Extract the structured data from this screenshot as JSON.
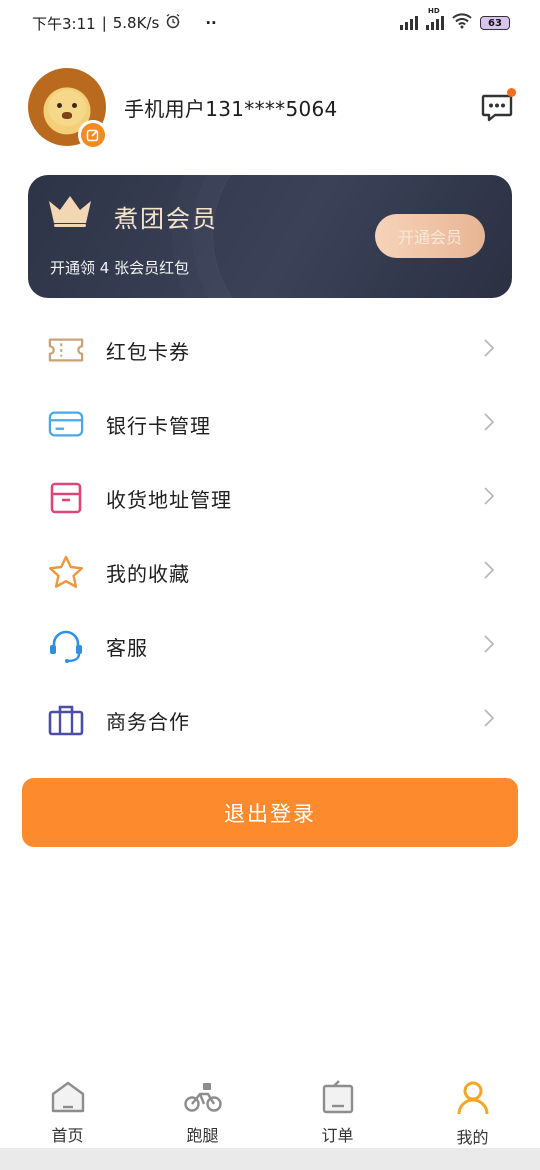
{
  "status_bar": {
    "time": "下午3:11",
    "speed": "5.8K/s",
    "dots": "··",
    "network_type": "HD",
    "battery": "63"
  },
  "profile": {
    "username": "手机用户131****5064"
  },
  "membership": {
    "title": "煮团会员",
    "subtitle": "开通领 4 张会员红包",
    "button_label": "开通会员"
  },
  "menu": {
    "items": [
      {
        "label": "红包卡券",
        "icon": "ticket-icon",
        "color": "#c9a27a"
      },
      {
        "label": "银行卡管理",
        "icon": "bank-card-icon",
        "color": "#4aa8e6"
      },
      {
        "label": "收货地址管理",
        "icon": "address-box-icon",
        "color": "#e0457a"
      },
      {
        "label": "我的收藏",
        "icon": "star-icon",
        "color": "#f0953a"
      },
      {
        "label": "客服",
        "icon": "headset-icon",
        "color": "#2f8fe0"
      },
      {
        "label": "商务合作",
        "icon": "briefcase-icon",
        "color": "#4b4ea8"
      }
    ]
  },
  "logout": {
    "label": "退出登录",
    "color": "#fd8a2c"
  },
  "tabbar": {
    "tabs": [
      {
        "label": "首页",
        "icon": "home-icon"
      },
      {
        "label": "跑腿",
        "icon": "bike-icon"
      },
      {
        "label": "订单",
        "icon": "order-icon"
      },
      {
        "label": "我的",
        "icon": "profile-icon",
        "active": true
      }
    ],
    "accent": "#f5a623"
  }
}
